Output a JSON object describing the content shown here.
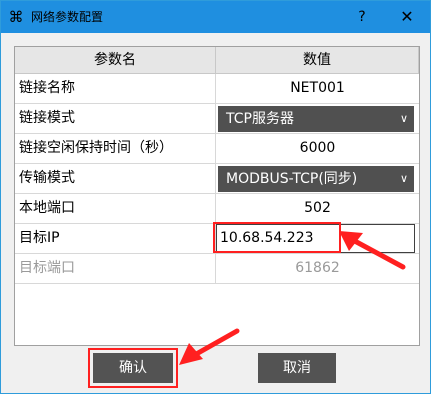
{
  "window": {
    "title": "网络参数配置",
    "help_label": "?",
    "close_label": "✕"
  },
  "table": {
    "headers": {
      "name": "参数名",
      "value": "数值"
    },
    "rows": [
      {
        "name": "链接名称",
        "value": "NET001",
        "type": "text"
      },
      {
        "name": "链接模式",
        "value": "TCP服务器",
        "type": "dropdown"
      },
      {
        "name": "链接空闲保持时间（秒）",
        "value": "6000",
        "type": "text"
      },
      {
        "name": "传输模式",
        "value": "MODBUS-TCP(同步)",
        "type": "dropdown"
      },
      {
        "name": "本地端口",
        "value": "502",
        "type": "text"
      },
      {
        "name": "目标IP",
        "value": "10.68.54.223",
        "type": "input"
      },
      {
        "name": "目标端口",
        "value": "61862",
        "type": "disabled"
      }
    ]
  },
  "buttons": {
    "confirm": "确认",
    "cancel": "取消"
  },
  "icons": {
    "app": "network-config-icon",
    "dropdown": "chevron-down-icon"
  },
  "colors": {
    "titlebar": "#1f8fe0",
    "button": "#535353",
    "annotation": "#ff2020"
  }
}
